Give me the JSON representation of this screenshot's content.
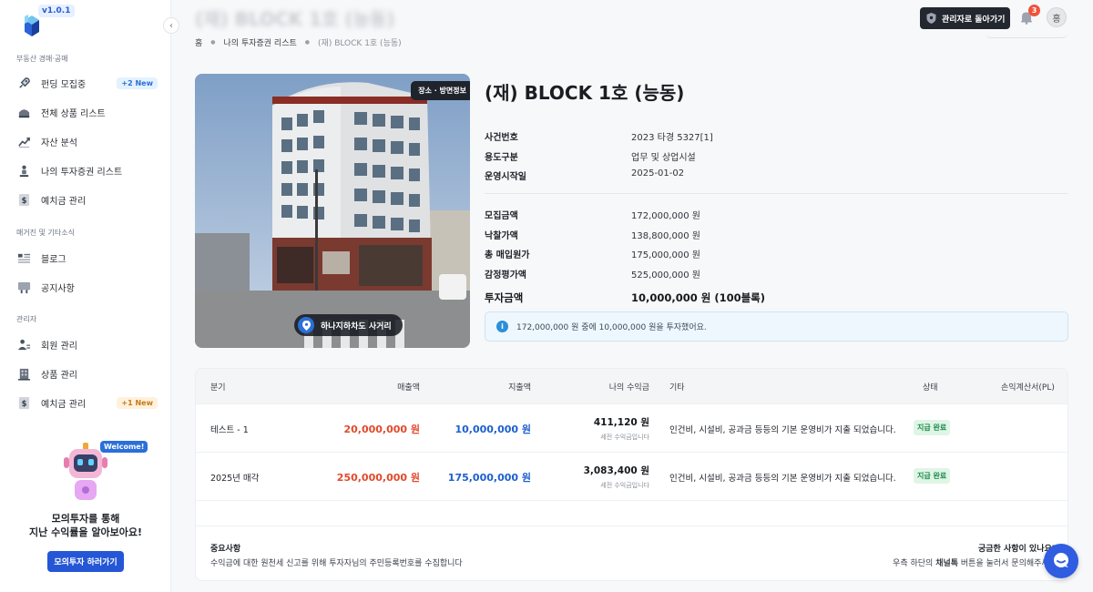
{
  "app": {
    "version": "v1.0.1",
    "page_title_blurred": "(재) BLOCK 1호 (능동)"
  },
  "sidebar": {
    "sections": [
      {
        "title": "부동산 경매·공매"
      },
      {
        "title": "매거진 및 기타소식"
      },
      {
        "title": "관리자"
      }
    ],
    "items": [
      {
        "label": "펀딩 모집중",
        "icon": "rocket-icon",
        "badge": "+2 New"
      },
      {
        "label": "전체 상품 리스트",
        "icon": "bag-icon"
      },
      {
        "label": "자산 분석",
        "icon": "trend-chart-icon"
      },
      {
        "label": "나의 투자증권 리스트",
        "icon": "person-icon"
      },
      {
        "label": "예치금 관리",
        "icon": "dollar-doc-icon"
      },
      {
        "label": "블로그",
        "icon": "article-icon"
      },
      {
        "label": "공지사항",
        "icon": "cart-icon"
      },
      {
        "label": "회원 관리",
        "icon": "users-icon"
      },
      {
        "label": "상품 관리",
        "icon": "building-icon"
      },
      {
        "label": "예치금 관리",
        "icon": "dollar-doc-icon",
        "badge": "+1 New"
      }
    ],
    "promo": {
      "welcome": "Welcome!",
      "line1": "모의투자를 통해",
      "line2": "지난 수익률을 알아보아요!",
      "button": "모의투자 하러가기"
    }
  },
  "header": {
    "admin_button": "관리자로 돌아가기",
    "notification_count": "3",
    "avatar_initial": "홍"
  },
  "breadcrumb": [
    "홈",
    "나의 투자증권 리스트",
    "(재) BLOCK 1호 (능동)"
  ],
  "photo": {
    "tag": "장소 · 방면정보",
    "location": "하나지하차도 사거리"
  },
  "product": {
    "title": "(재) BLOCK 1호 (능동)",
    "details": [
      {
        "k": "사건번호",
        "v": "2023 타경 5327[1]"
      },
      {
        "k": "용도구분",
        "v": "업무 및 상업시설"
      },
      {
        "k": "운영시작일",
        "v": "2025-01-02"
      }
    ],
    "amounts": [
      {
        "k": "모집금액",
        "v": "172,000,000 원"
      },
      {
        "k": "낙찰가액",
        "v": "138,800,000 원"
      },
      {
        "k": "총 매입원가",
        "v": "175,000,000 원"
      },
      {
        "k": "감정평가액",
        "v": "525,000,000 원"
      }
    ],
    "invest": {
      "k": "투자금액",
      "v": "10,000,000 원 (100블록)"
    },
    "info": "172,000,000 원 중에 10,000,000 원을 투자했어요."
  },
  "table": {
    "headers": {
      "quarter": "분기",
      "revenue": "매출액",
      "expense": "지출액",
      "profit": "나의 수익금",
      "etc": "기타",
      "status": "상태",
      "pl": "손익계산서(PL)"
    },
    "rows": [
      {
        "quarter": "테스트 - 1",
        "revenue": "20,000,000 원",
        "expense": "10,000,000 원",
        "profit": "411,120 원",
        "profit_sub": "세전 수익금입니다",
        "etc": "인건비, 시설비, 공과금 등등의 기본 운영비가 지출 되었습니다.",
        "status": "지급 완료"
      },
      {
        "quarter": "2025년 매각",
        "revenue": "250,000,000 원",
        "expense": "175,000,000 원",
        "profit": "3,083,400 원",
        "profit_sub": "세전 수익금입니다",
        "etc": "인건비, 시설비, 공과금 등등의 기본 운영비가 지출 되었습니다.",
        "status": "지급 완료"
      }
    ],
    "notes": {
      "left_title": "중요사항",
      "left_text": "수익금에 대한 원천세 신고를 위해 투자자님의 주민등록번호를 수집합니다",
      "right_title": "궁금한 사항이 있나요?",
      "right_pre": "우측 하단의",
      "right_bold": "채널톡",
      "right_post": "버튼을 눌러서 문의해주세요"
    }
  },
  "colors": {
    "primary": "#2556d6",
    "revenue": "#e2492b",
    "expense": "#1d5fcf",
    "status_bg": "#dff5e6",
    "status_fg": "#1f8b4c"
  }
}
